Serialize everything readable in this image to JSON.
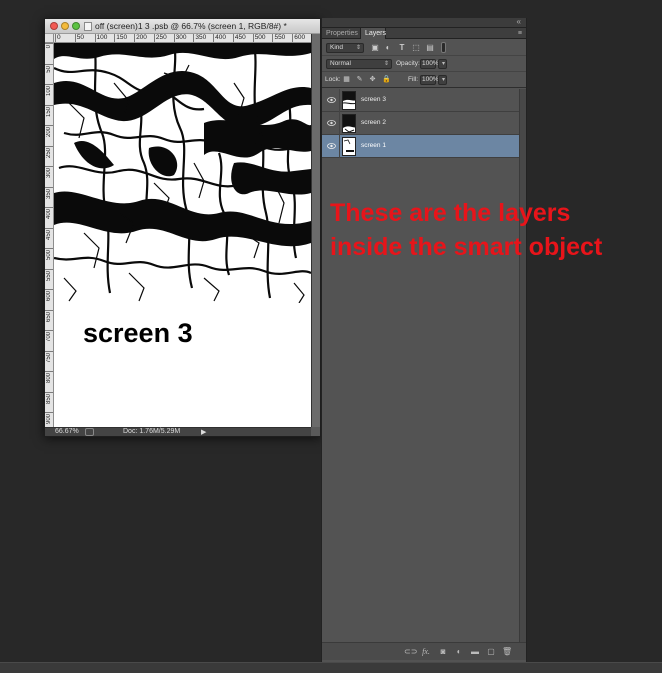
{
  "document": {
    "title": "off (screen)1 3 .psb @ 66.7% (screen 1, RGB/8#) *",
    "ruler_top_labels": [
      "0",
      "50",
      "100",
      "150",
      "200",
      "250",
      "300",
      "350",
      "400",
      "450",
      "500",
      "550",
      "600"
    ],
    "ruler_left_labels": [
      "0",
      "50",
      "100",
      "150",
      "200",
      "250",
      "300",
      "350",
      "400",
      "450",
      "500",
      "550",
      "600",
      "650",
      "700",
      "750",
      "800",
      "850",
      "900"
    ],
    "canvas_text": "screen 3",
    "zoom": "66.67%",
    "doc_info": "Doc: 1.76M/5.29M"
  },
  "panel": {
    "tabs": [
      "Properties",
      "Layers"
    ],
    "active_tab": "Layers",
    "filter_kind": "Kind",
    "blend_mode": "Normal",
    "opacity_label": "Opacity:",
    "opacity_value": "100%",
    "lock_label": "Lock:",
    "fill_label": "Fill:",
    "fill_value": "100%",
    "layers": [
      {
        "name": "screen 3",
        "selected": false,
        "visible": true
      },
      {
        "name": "screen 2",
        "selected": false,
        "visible": true
      },
      {
        "name": "screen 1",
        "selected": true,
        "visible": true
      }
    ]
  },
  "annotation": "These are the layers inside the smart object",
  "colors": {
    "annotation": "#e8141a",
    "selected_layer": "#6c86a3",
    "panel_bg": "#535353",
    "app_bg": "#282828"
  }
}
